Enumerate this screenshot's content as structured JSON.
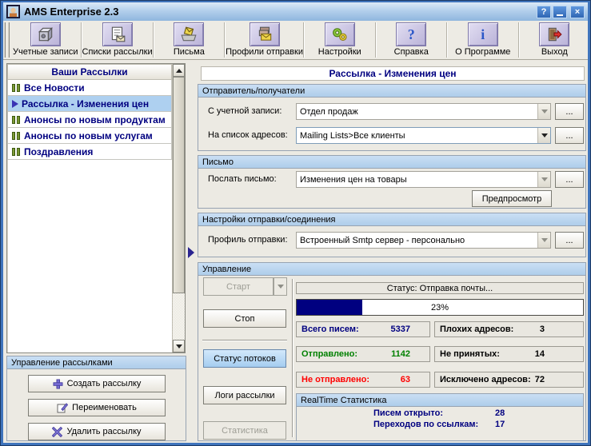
{
  "window": {
    "title": "AMS Enterprise 2.3",
    "controls": {
      "help": "?",
      "close": "×"
    }
  },
  "toolbar": {
    "buttons": [
      {
        "label": "Учетные записи",
        "icon": "accounts-icon"
      },
      {
        "label": "Списки рассылки",
        "icon": "mailing-lists-icon"
      },
      {
        "label": "Письма",
        "icon": "letters-icon"
      },
      {
        "label": "Профили отправки",
        "icon": "send-profiles-icon"
      },
      {
        "label": "Настройки",
        "icon": "settings-icon"
      },
      {
        "label": "Справка",
        "icon": "help-icon",
        "glyph": "?"
      },
      {
        "label": "О Программе",
        "icon": "about-icon",
        "glyph": "i"
      },
      {
        "label": "Выход",
        "icon": "exit-icon"
      }
    ]
  },
  "sidebar": {
    "header": "Ваши Рассылки",
    "items": [
      {
        "label": "Все Новости",
        "state": "paused"
      },
      {
        "label": "Рассылка - Изменения цен",
        "state": "running",
        "selected": true
      },
      {
        "label": "Анонсы по новым продуктам",
        "state": "paused"
      },
      {
        "label": "Анонсы по новым услугам",
        "state": "paused"
      },
      {
        "label": "Поздравления",
        "state": "paused"
      }
    ],
    "manage": {
      "header": "Управление рассылками",
      "create_label": "Создать рассылку",
      "rename_label": "Переименовать",
      "delete_label": "Удалить рассылку"
    }
  },
  "main": {
    "title": "Рассылка - Изменения цен",
    "sender": {
      "header": "Отправитель/получатели",
      "account_label": "С учетной записи:",
      "account_value": "Отдел продаж",
      "list_label": "На список адресов:",
      "list_value": "Mailing Lists>Все клиенты",
      "browse_label": "..."
    },
    "letter": {
      "header": "Письмо",
      "send_label": "Послать письмо:",
      "send_value": "Изменения цен на товары",
      "browse_label": "...",
      "preview_label": "Предпросмотр"
    },
    "profile": {
      "header": "Настройки отправки/соединения",
      "profile_label": "Профиль отправки:",
      "profile_value": "Встроенный Smtp сервер - персонально",
      "browse_label": "..."
    },
    "control": {
      "header": "Управление",
      "start_label": "Старт",
      "stop_label": "Стоп",
      "threads_label": "Статус потоков",
      "logs_label": "Логи рассылки",
      "stats_label": "Статистика",
      "status_text": "Статус: Отправка почты...",
      "progress": {
        "percent": 23,
        "label": "23%",
        "fill_color": "#000080"
      },
      "stats": [
        {
          "label": "Всего писем:",
          "value": "5337",
          "color": "#000080"
        },
        {
          "label": "Плохих адресов:",
          "value": "3",
          "color": "#000000"
        },
        {
          "label": "Отправлено:",
          "value": "1142",
          "color": "#008000"
        },
        {
          "label": "Не принятых:",
          "value": "14",
          "color": "#000000"
        },
        {
          "label": "Не отправлено:",
          "value": "63",
          "color": "#ff0000"
        },
        {
          "label": "Исключено адресов:",
          "value": "72",
          "color": "#000000"
        }
      ],
      "realtime": {
        "header": "RealTime Статистика",
        "rows": [
          {
            "label": "Писем открыто:",
            "value": "28"
          },
          {
            "label": "Переходов по ссылкам:",
            "value": "17"
          }
        ]
      }
    }
  },
  "colors": {
    "selection_blue": "#aed0f0",
    "group_header_blue": "#b9d4ee",
    "accent_navy": "#000080",
    "success_green": "#008000",
    "error_red": "#ff0000"
  }
}
